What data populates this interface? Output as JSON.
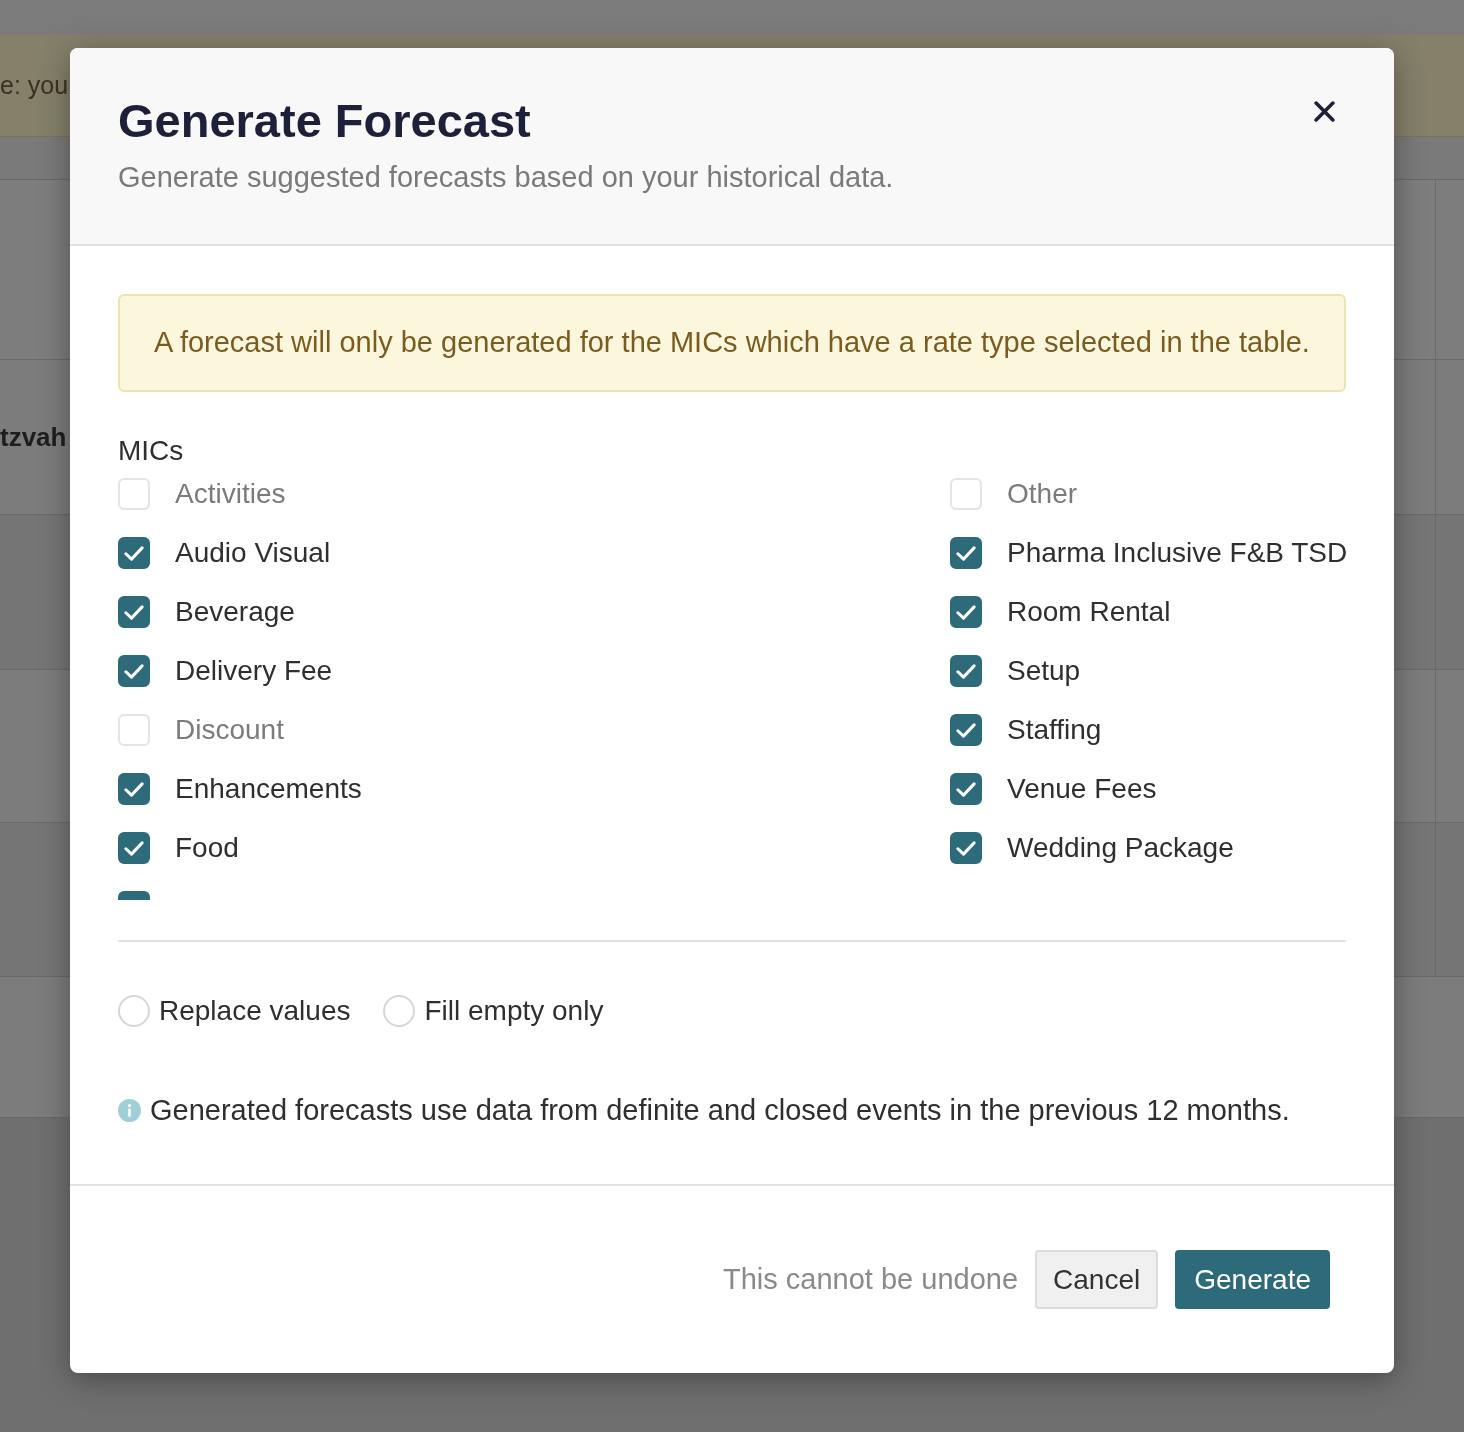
{
  "background": {
    "banner_text": "e: you",
    "row_text": "tzvah"
  },
  "dialog": {
    "title": "Generate Forecast",
    "subtitle": "Generate suggested forecasts based on your historical data.",
    "alert": "A forecast will only be generated for the MICs which have a rate type selected in the table.",
    "mics": {
      "label": "MICs",
      "columns": [
        {
          "items": [
            {
              "kind": "option",
              "label": "Activities",
              "checked": false
            },
            {
              "kind": "option",
              "label": "Audio Visual",
              "checked": true
            },
            {
              "kind": "option",
              "label": "Beverage",
              "checked": true
            },
            {
              "kind": "option",
              "label": "Delivery Fee",
              "checked": true
            },
            {
              "kind": "option",
              "label": "Discount",
              "checked": false
            },
            {
              "kind": "option",
              "label": "Enhancements",
              "checked": true
            },
            {
              "kind": "option",
              "label": "Food",
              "checked": true
            },
            {
              "kind": "cut_off",
              "checked": true
            }
          ]
        },
        {
          "items": [
            {
              "kind": "option",
              "label": "Other",
              "checked": false
            },
            {
              "kind": "option",
              "label": "Pharma Inclusive F&B TSD",
              "checked": true
            },
            {
              "kind": "option",
              "label": "Room Rental",
              "checked": true
            },
            {
              "kind": "option",
              "label": "Setup",
              "checked": true
            },
            {
              "kind": "option",
              "label": "Staffing",
              "checked": true
            },
            {
              "kind": "option",
              "label": "Venue Fees",
              "checked": true
            },
            {
              "kind": "option",
              "label": "Wedding Package",
              "checked": true
            }
          ]
        }
      ]
    },
    "modes": [
      {
        "label": "Replace values",
        "selected": false
      },
      {
        "label": "Fill empty only",
        "selected": false
      }
    ],
    "info": "Generated forecasts use data from definite and closed events in the previous 12 months.",
    "footer": {
      "warning": "This cannot be undone",
      "buttons": [
        {
          "kind": "secondary",
          "label": "Cancel"
        },
        {
          "kind": "primary",
          "label": "Generate"
        }
      ]
    }
  }
}
